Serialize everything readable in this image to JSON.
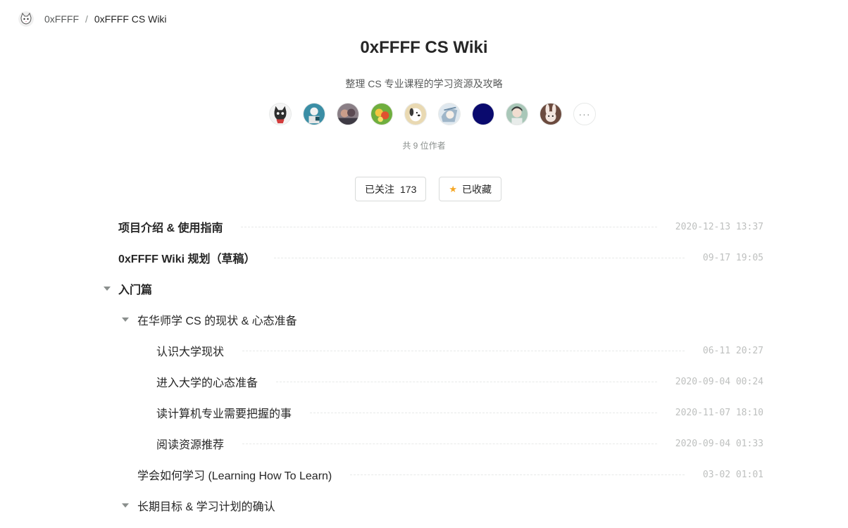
{
  "breadcrumb": {
    "home": "0xFFFF",
    "separator": "/",
    "current": "0xFFFF CS Wiki"
  },
  "header": {
    "title": "0xFFFF CS Wiki",
    "subtitle": "整理 CS 专业课程的学习资源及攻略"
  },
  "authors": {
    "avatars": [
      "avatar-cat",
      "avatar-teal-person",
      "avatar-photo",
      "avatar-fruit",
      "avatar-dog",
      "avatar-anime",
      "avatar-navy",
      "avatar-green-person",
      "avatar-rabbit"
    ],
    "more_label": "···",
    "count_label": "共 9 位作者"
  },
  "actions": {
    "follow_label": "已关注",
    "follow_count": "173",
    "collect_label": "已收藏",
    "collect_icon": "star-icon"
  },
  "toc": {
    "items": [
      {
        "title": "项目介绍 & 使用指南",
        "date": "2020-12-13 13:37"
      },
      {
        "title": "0xFFFF Wiki 规划（草稿）",
        "date": "09-17 19:05"
      },
      {
        "title": "入门篇",
        "date": ""
      },
      {
        "title": "在华师学 CS 的现状 & 心态准备",
        "date": ""
      },
      {
        "title": "认识大学现状",
        "date": "06-11 20:27"
      },
      {
        "title": "进入大学的心态准备",
        "date": "2020-09-04 00:24"
      },
      {
        "title": "读计算机专业需要把握的事",
        "date": "2020-11-07 18:10"
      },
      {
        "title": "阅读资源推荐",
        "date": "2020-09-04 01:33"
      },
      {
        "title": "学会如何学习 (Learning How To Learn)",
        "date": "03-02 01:01"
      },
      {
        "title": "长期目标 & 学习计划的确认",
        "date": ""
      }
    ]
  },
  "colors": {
    "text": "#262626",
    "muted": "#8a8f8d",
    "date": "#bec0bf",
    "star": "#f5a623"
  }
}
